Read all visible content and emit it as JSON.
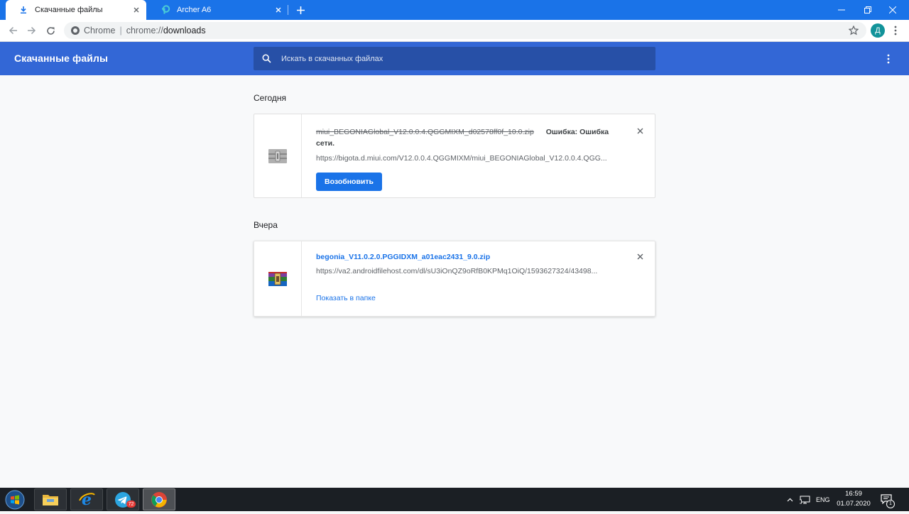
{
  "browser": {
    "tabs": [
      {
        "title": "Скачанные файлы",
        "icon": "download-icon",
        "active": true
      },
      {
        "title": "Archer A6",
        "icon": "tp-link-icon",
        "active": false
      }
    ],
    "omnibox": {
      "chip": "Chrome",
      "scheme": "chrome://",
      "host": "downloads"
    },
    "profile_initial": "Д"
  },
  "downloads": {
    "title": "Скачанные файлы",
    "search_placeholder": "Искать в скачанных файлах",
    "groups": [
      {
        "date": "Сегодня",
        "items": [
          {
            "file": "miui_BEGONIAGlobal_V12.0.0.4.QGGMIXM_d02578ff0f_10.0.zip",
            "status": "Ошибка: Ошибка",
            "status_cont": "сети.",
            "url": "https://bigota.d.miui.com/V12.0.0.4.QGGMIXM/miui_BEGONIAGlobal_V12.0.0.4.QGG...",
            "action": "Возобновить"
          }
        ]
      },
      {
        "date": "Вчера",
        "items": [
          {
            "file": "begonia_V11.0.2.0.PGGIDXM_a01eac2431_9.0.zip",
            "url": "https://va2.androidfilehost.com/dl/sU3iOnQZ9oRfB0KPMq1OiQ/1593627324/43498...",
            "action": "Показать в папке"
          }
        ]
      }
    ]
  },
  "taskbar": {
    "telegram_badge": "72",
    "language": "ENG",
    "time": "16:59",
    "date": "01.07.2020",
    "notifications_count": "1"
  },
  "colors": {
    "tabstrip": "#1a73e8",
    "header": "#3367d6",
    "accent": "#1a73e8",
    "taskbar": "#1b1f24"
  }
}
